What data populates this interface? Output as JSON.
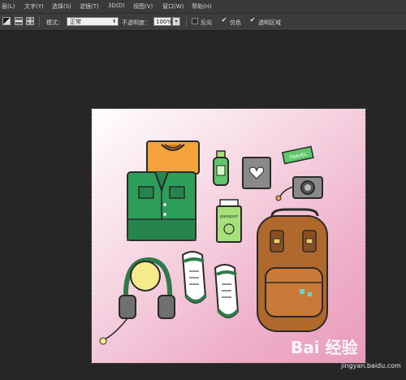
{
  "menu": {
    "items": [
      "层(L)",
      "文字(Y)",
      "选择(S)",
      "滤镜(T)",
      "3D(D)",
      "视图(V)",
      "窗口(W)",
      "帮助(H)"
    ]
  },
  "options": {
    "mode_label": "模式：",
    "mode_value": "正常",
    "opacity_label": "不透明度：",
    "opacity_value": "100%",
    "reverse_label": "反向",
    "dither_label": "仿色",
    "transparency_label": "透明区域",
    "reverse_checked": false,
    "dither_checked": true,
    "transparency_checked": true
  },
  "canvas": {
    "travel_tag": "TRAVEL",
    "passport_text": "passport"
  },
  "watermark": {
    "logo": "Bai 经验",
    "url": "jingyan.baidu.com"
  },
  "colors": {
    "shirt": "#2e9e5b",
    "headphones": "#2f7a4b",
    "backpack": "#b0682c",
    "canvas_gradient_end": "#e89bbb"
  }
}
